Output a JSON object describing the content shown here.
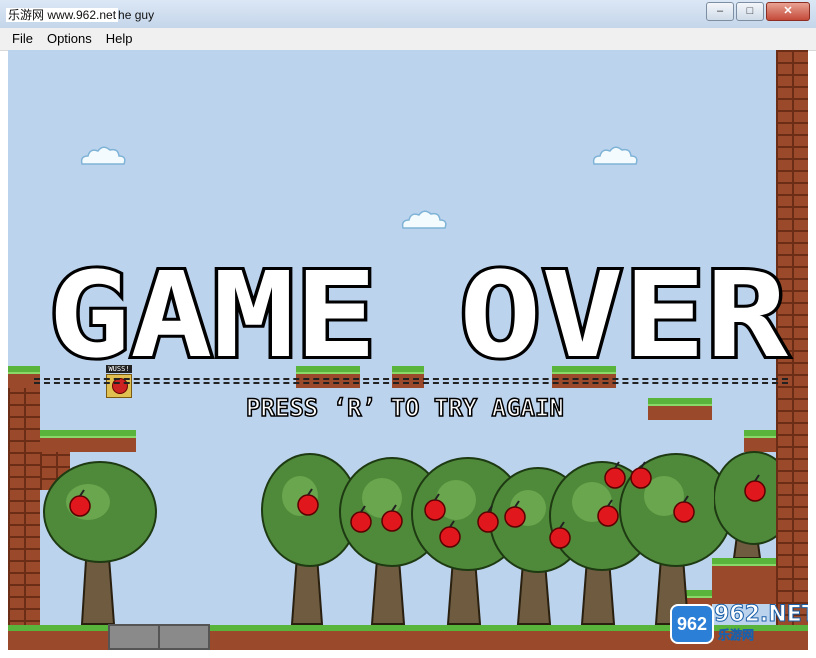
{
  "window": {
    "title_watermark": "乐游网 www.962.net",
    "title_suffix": "he guy",
    "minimize_glyph": "–",
    "maximize_glyph": "□",
    "close_glyph": "✕"
  },
  "menu": {
    "items": [
      {
        "label": "File"
      },
      {
        "label": "Options"
      },
      {
        "label": "Help"
      }
    ]
  },
  "game": {
    "game_over_text": "GAME OVER",
    "press_r_text": "PRESS ‘R’ TO TRY AGAIN",
    "save_label": "WUSS!",
    "sky_color": "#bcd3ee",
    "brick_color": "#9a4a2a",
    "grass_color": "#58b43a",
    "apple_color": "#e0171c",
    "icons": [
      "cloud-icon",
      "tree-icon",
      "apple-icon",
      "save-point-icon"
    ]
  },
  "watermark": {
    "badge": "962",
    "main": "962.NET",
    "sub": "乐游网"
  }
}
